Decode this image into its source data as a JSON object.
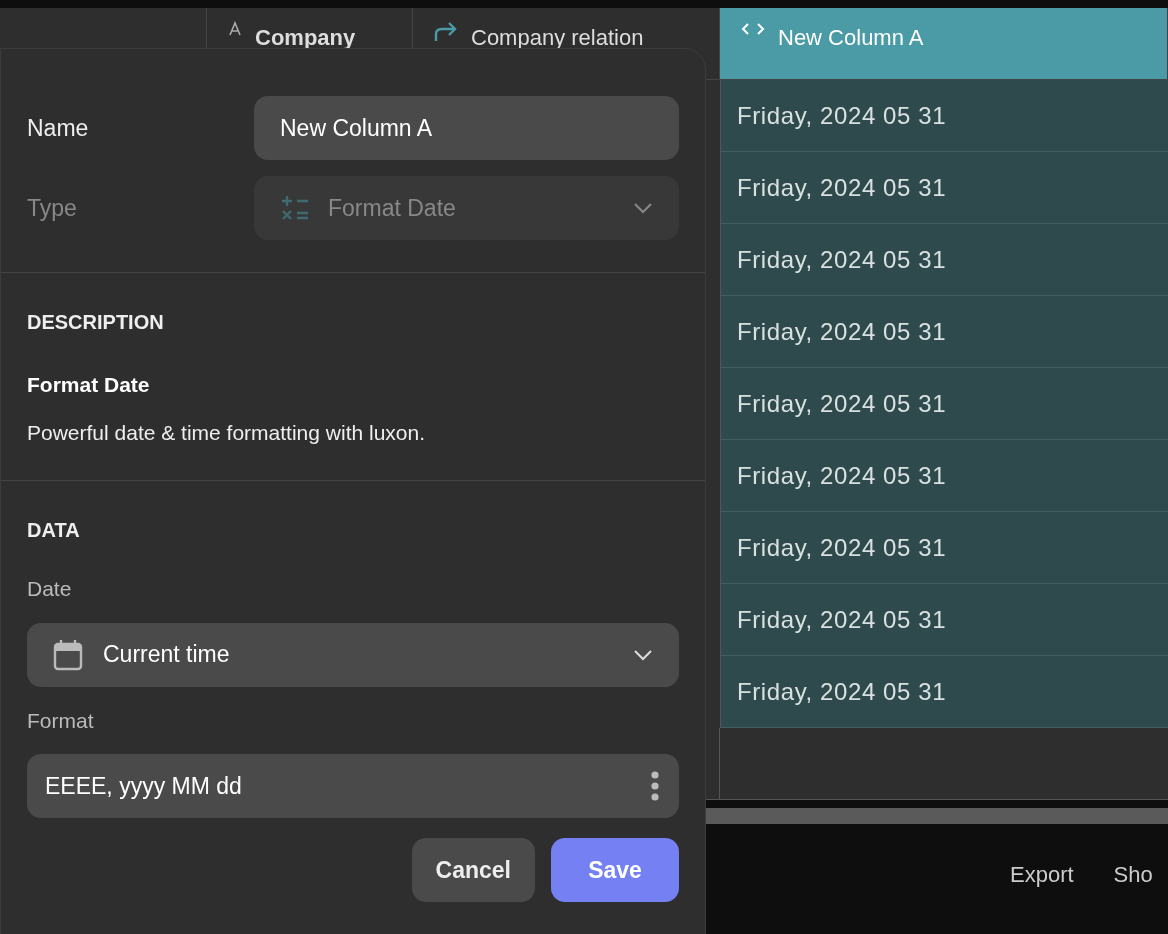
{
  "table": {
    "columns": [
      {
        "label": "Company",
        "kind": "text",
        "selected": false
      },
      {
        "label": "Company relation",
        "kind": "relation",
        "selected": false
      },
      {
        "label": "New Column A",
        "kind": "code",
        "selected": true
      }
    ],
    "rows": [
      "Friday, 2024 05 31",
      "Friday, 2024 05 31",
      "Friday, 2024 05 31",
      "Friday, 2024 05 31",
      "Friday, 2024 05 31",
      "Friday, 2024 05 31",
      "Friday, 2024 05 31",
      "Friday, 2024 05 31",
      "Friday, 2024 05 31"
    ]
  },
  "footer": {
    "actions": [
      "Export",
      "Sho"
    ]
  },
  "editor": {
    "name": {
      "label": "Name",
      "value": "New Column A"
    },
    "type": {
      "label": "Type",
      "value": "Format Date",
      "disabled": true
    },
    "description": {
      "heading": "DESCRIPTION",
      "title": "Format Date",
      "text": "Powerful date & time formatting with luxon."
    },
    "data": {
      "heading": "DATA",
      "date": {
        "label": "Date",
        "value": "Current time"
      },
      "format": {
        "label": "Format",
        "value": "EEEE, yyyy MM dd"
      }
    },
    "buttons": [
      {
        "label": "Cancel",
        "kind": "secondary"
      },
      {
        "label": "Save",
        "kind": "primary"
      }
    ]
  }
}
